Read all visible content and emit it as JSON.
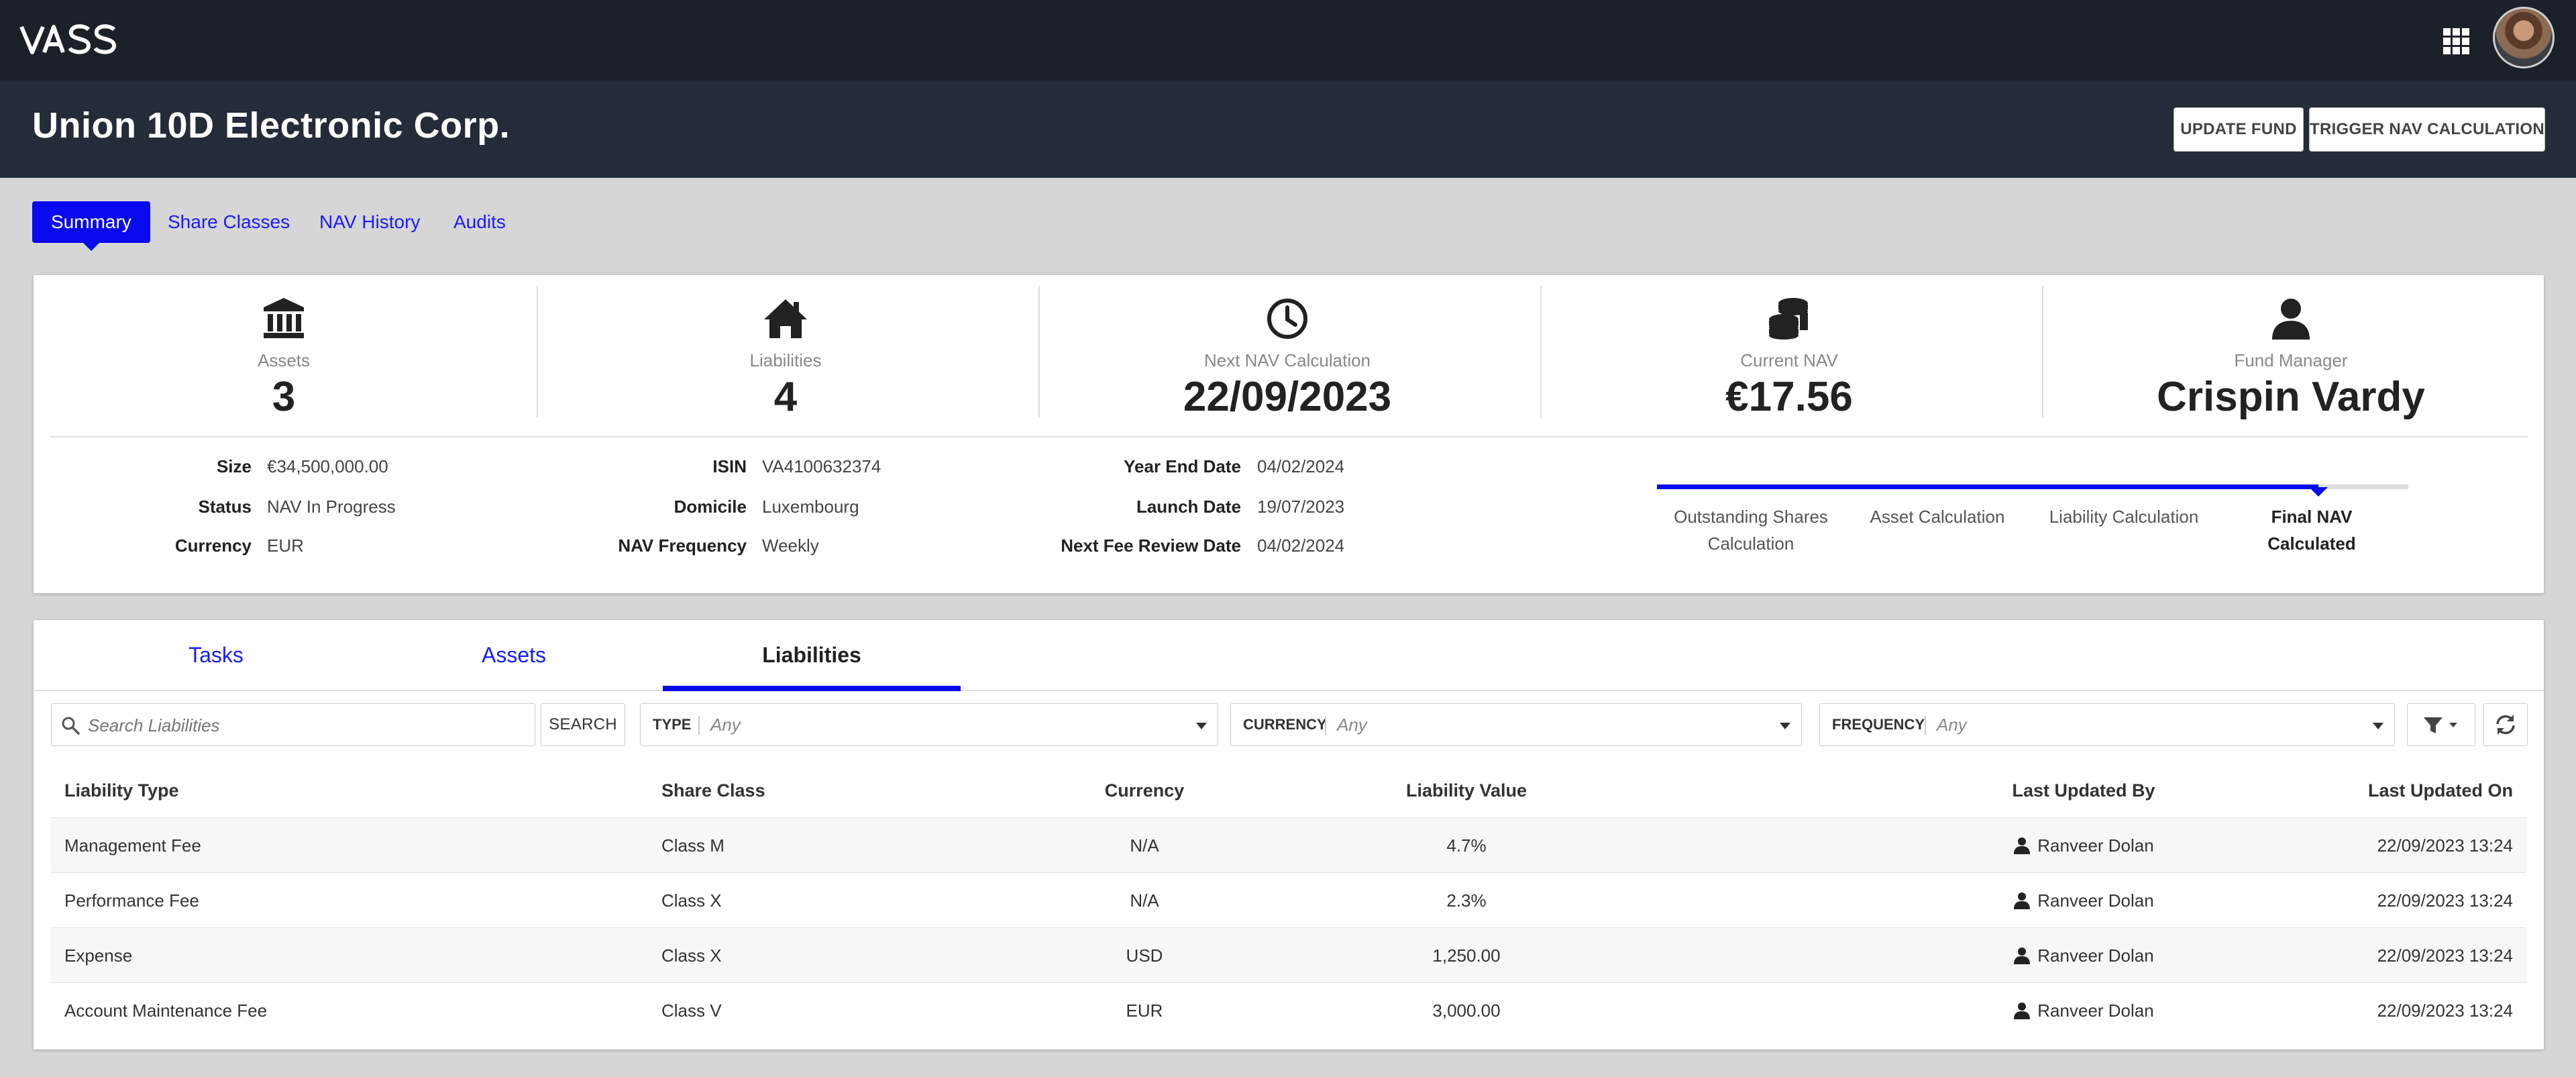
{
  "app": {
    "logo_text": "VASS"
  },
  "header": {
    "fund_name": "Union 10D Electronic Corp.",
    "update_button": "UPDATE FUND",
    "trigger_button": "TRIGGER NAV CALCULATION"
  },
  "nav_tabs": [
    "Summary",
    "Share Classes",
    "NAV History",
    "Audits"
  ],
  "kpis": [
    {
      "icon": "bank-icon",
      "label": "Assets",
      "value": "3"
    },
    {
      "icon": "house-icon",
      "label": "Liabilities",
      "value": "4"
    },
    {
      "icon": "clock-icon",
      "label": "Next NAV Calculation",
      "value": "22/09/2023"
    },
    {
      "icon": "coins-icon",
      "label": "Current NAV",
      "value": "€17.56"
    },
    {
      "icon": "user-icon",
      "label": "Fund Manager",
      "value": "Crispin Vardy"
    }
  ],
  "details": {
    "size_label": "Size",
    "size": "€34,500,000.00",
    "status_label": "Status",
    "status": "NAV In Progress",
    "currency_label": "Currency",
    "currency": "EUR",
    "isin_label": "ISIN",
    "isin": "VA4100632374",
    "domicile_label": "Domicile",
    "domicile": "Luxembourg",
    "nav_frequency_label": "NAV Frequency",
    "nav_frequency": "Weekly",
    "year_end_label": "Year End Date",
    "year_end": "04/02/2024",
    "launch_label": "Launch Date",
    "launch": "19/07/2023",
    "fee_review_label": "Next Fee Review Date",
    "fee_review": "04/02/2024"
  },
  "nav_progress": {
    "steps": [
      "Outstanding Shares\nCalculation",
      "Asset Calculation",
      "Liability Calculation",
      "Final NAV\nCalculated"
    ],
    "current_step": 3,
    "fill_fraction": 0.88
  },
  "section_tabs": [
    "Tasks",
    "Assets",
    "Liabilities"
  ],
  "toolbar": {
    "search_placeholder": "Search Liabilities",
    "search_button": "SEARCH",
    "type_label": "TYPE",
    "type_value": "Any",
    "currency_label": "CURRENCY",
    "currency_value": "Any",
    "frequency_label": "FREQUENCY",
    "frequency_value": "Any"
  },
  "table": {
    "headers": [
      "Liability Type",
      "Share Class",
      "Currency",
      "Liability Value",
      "Last Updated By",
      "Last Updated On"
    ],
    "rows": [
      [
        "Management Fee",
        "Class M",
        "N/A",
        "4.7%",
        "Ranveer Dolan",
        "22/09/2023 13:24"
      ],
      [
        "Performance Fee",
        "Class X",
        "N/A",
        "2.3%",
        "Ranveer Dolan",
        "22/09/2023 13:24"
      ],
      [
        "Expense",
        "Class X",
        "USD",
        "1,250.00",
        "Ranveer Dolan",
        "22/09/2023 13:24"
      ],
      [
        "Account Maintenance Fee",
        "Class V",
        "EUR",
        "3,000.00",
        "Ranveer Dolan",
        "22/09/2023 13:24"
      ]
    ]
  },
  "colors": {
    "topbar": "#1b2129",
    "subheader": "#232c38",
    "accent": "#0a0aee",
    "link": "#1a1aff"
  }
}
